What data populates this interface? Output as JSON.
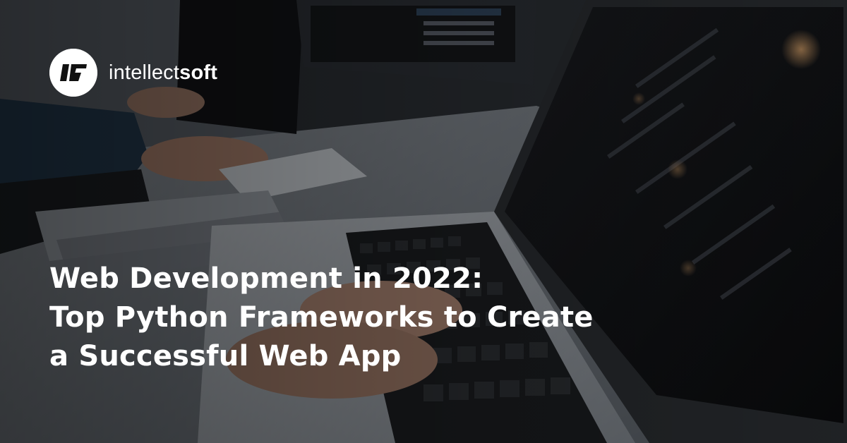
{
  "brand": {
    "name_light": "intellect",
    "name_bold": "soft",
    "logo_icon": "intellectsoft-logo-icon",
    "logo_bg_color": "#ffffff",
    "logo_fg_color": "#111111"
  },
  "headline": {
    "line1": "Web Development in 2022:",
    "line2": "Top Python Frameworks to Create",
    "line3": "a Successful Web App",
    "color": "#ffffff"
  },
  "background": {
    "description_icon": "laptop-photo-background"
  }
}
